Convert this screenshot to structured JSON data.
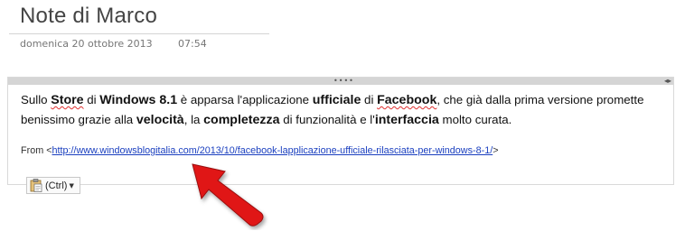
{
  "page": {
    "title": "Note di Marco",
    "date": "domenica 20 ottobre 2013",
    "time": "07:54"
  },
  "note": {
    "paragraph": [
      {
        "t": "Sullo ",
        "b": false
      },
      {
        "t": "Store",
        "b": true,
        "sq": true
      },
      {
        "t": " di ",
        "b": false
      },
      {
        "t": "Windows 8.1",
        "b": true
      },
      {
        "t": " è apparsa l'applicazione ",
        "b": false
      },
      {
        "t": "ufficiale",
        "b": true
      },
      {
        "t": " di ",
        "b": false
      },
      {
        "t": "Facebook",
        "b": true,
        "sq": true
      },
      {
        "t": ", che già dalla prima versione promette benissimo grazie alla ",
        "b": false
      },
      {
        "t": "velocità",
        "b": true
      },
      {
        "t": ", la ",
        "b": false
      },
      {
        "t": "completezza",
        "b": true
      },
      {
        "t": " di funzionalità e l'",
        "b": false
      },
      {
        "t": "interfaccia",
        "b": true
      },
      {
        "t": " molto curata.",
        "b": false
      }
    ],
    "from_prefix": "From <",
    "link_text": "http://www.windowsblogitalia.com/2013/10/facebook-lapplicazione-ufficiale-rilasciata-per-windows-8-1/",
    "from_suffix": ">"
  },
  "paste_options": {
    "label": "(Ctrl)",
    "icon": "clipboard-icon"
  },
  "container": {
    "grip_glyph": "••••",
    "resize_glyph": "◂▸"
  },
  "colors": {
    "link": "#1a3fbf",
    "arrow": "#e01818",
    "spellcheck": "#e03030"
  }
}
